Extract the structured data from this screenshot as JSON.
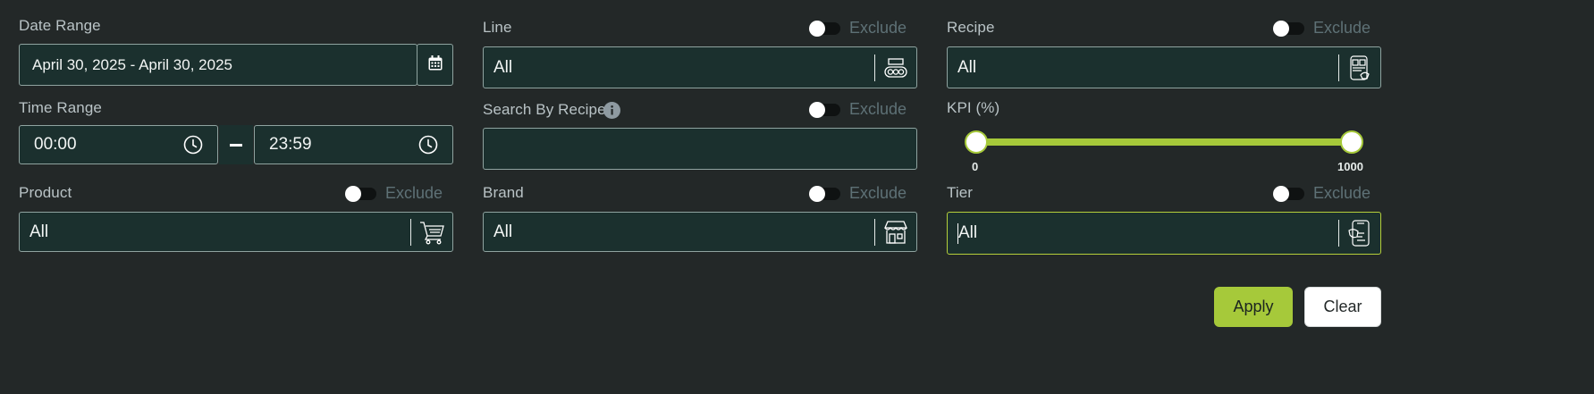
{
  "date_range": {
    "label": "Date Range",
    "value": "April 30, 2025 - April 30, 2025",
    "icon": "calendar-icon"
  },
  "time_range": {
    "label": "Time Range",
    "start": "00:00",
    "end": "23:59",
    "separator": "–",
    "icon": "clock-icon"
  },
  "product": {
    "label": "Product",
    "value": "All",
    "exclude_label": "Exclude",
    "icon": "shopping-cart-icon"
  },
  "line": {
    "label": "Line",
    "value": "All",
    "exclude_label": "Exclude",
    "icon": "conveyor-icon"
  },
  "search_by_recipe": {
    "label": "Search By Recipe",
    "value": "",
    "exclude_label": "Exclude",
    "icon": "info-icon"
  },
  "brand": {
    "label": "Brand",
    "value": "All",
    "exclude_label": "Exclude",
    "icon": "storefront-icon"
  },
  "recipe": {
    "label": "Recipe",
    "value": "All",
    "exclude_label": "Exclude",
    "icon": "recipe-phone-icon"
  },
  "kpi": {
    "label": "KPI (%)",
    "min": 0,
    "max": 1000,
    "min_label": "0",
    "max_label": "1000",
    "low": 0,
    "high": 1000
  },
  "tier": {
    "label": "Tier",
    "value": "All",
    "exclude_label": "Exclude",
    "icon": "tier-phone-icon"
  },
  "actions": {
    "apply_label": "Apply",
    "clear_label": "Clear"
  },
  "colors": {
    "accent": "#a6c93a",
    "field_bg": "#1b302e",
    "page_bg": "#232828",
    "focus_border": "#b5cf3a"
  }
}
